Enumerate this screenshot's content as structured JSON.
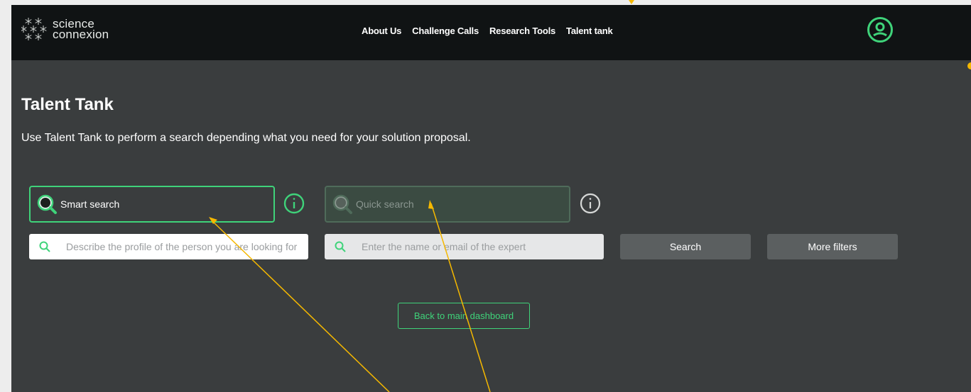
{
  "header": {
    "logo_line1": "science",
    "logo_line2": "connexion",
    "nav": [
      "About Us",
      "Challenge Calls",
      "Research Tools",
      "Talent tank"
    ]
  },
  "main": {
    "title": "Talent Tank",
    "description": "Use Talent Tank to perform a search depending what you need for your solution proposal.",
    "smart_search_label": "Smart search",
    "quick_search_label": "Quick search",
    "smart_search_placeholder": "Describe the profile of the person you are looking for",
    "quick_search_placeholder": "Enter the name or email of the expert",
    "search_button": "Search",
    "more_filters_button": "More filters",
    "back_button": "Back to main dashboard"
  },
  "colors": {
    "accent": "#3fd37a",
    "topbar": "#101314",
    "background": "#3a3d3e",
    "annotation": "#f5b800"
  },
  "icons": [
    "logo-snowflake-icon",
    "account-icon",
    "magnifier-icon",
    "info-icon",
    "search-icon"
  ]
}
